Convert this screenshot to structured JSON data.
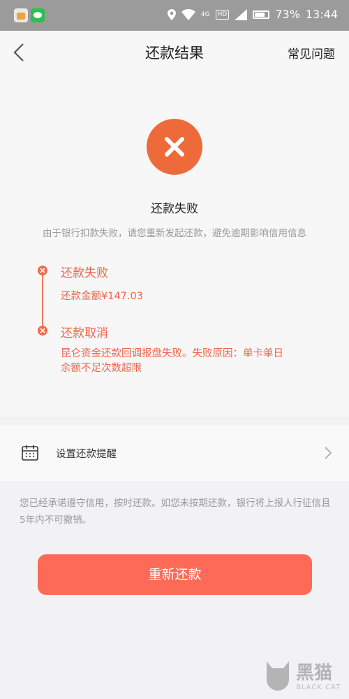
{
  "status_bar": {
    "battery": "73%",
    "time": "13:44",
    "network": "4G",
    "hd": "HD"
  },
  "nav": {
    "title": "还款结果",
    "faq": "常见问题"
  },
  "result": {
    "title": "还款失败",
    "description": "由于银行扣款失败，请您重新发起还款，避免逾期影响信用信息",
    "icon": "close-icon",
    "accent": "#ee6a3a"
  },
  "timeline": [
    {
      "title": "还款失败",
      "detail": "还款金额¥147.03"
    },
    {
      "title": "还款取消",
      "detail": "昆仑资金还款回调报盘失败。失败原因：单卡单日余额不足次数超限"
    }
  ],
  "reminder": {
    "label": "设置还款提醒",
    "icon": "calendar-icon"
  },
  "notice": "您已经承诺遵守信用，按时还款。如您未按期还款，银行将上报人行征信且5年内不可撤销。",
  "retry_button": {
    "label": "重新还款",
    "color": "#fd6a56"
  },
  "watermark": {
    "main": "黑猫",
    "sub": "BLACK CAT"
  }
}
